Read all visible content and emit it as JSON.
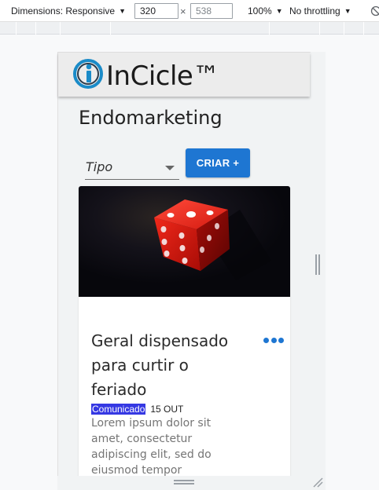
{
  "devtools": {
    "dimensions_label": "Dimensions: Responsive",
    "width_value": "320",
    "times_sign": "×",
    "height_placeholder": "538",
    "zoom": "100%",
    "throttling": "No throttling"
  },
  "app": {
    "logo_text": "InCicle™",
    "page_title": "Endomarketing",
    "filter": {
      "label": "Tipo"
    },
    "create_button": "CRIAR +"
  },
  "card": {
    "title": "Geral dispensado para curtir o feriado",
    "tag": "Comunicado",
    "date": "15 OUT",
    "body": "Lorem ipsum dolor sit amet, consectetur adipiscing elit, sed do eiusmod tempor",
    "menu_icon": "more-horizontal-icon",
    "image": "red-dice-image"
  },
  "colors": {
    "primary": "#1e76d2",
    "tag_bg": "#3538e3",
    "logo_blue": "#1a8bc8"
  }
}
